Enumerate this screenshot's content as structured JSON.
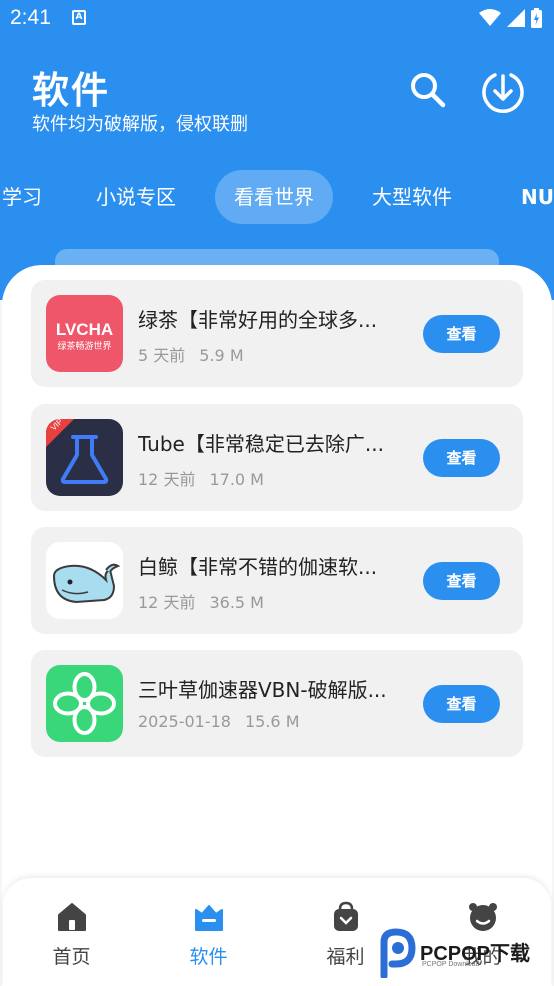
{
  "status_bar": {
    "time": "2:41",
    "notification_badge": "A"
  },
  "header": {
    "title": "软件",
    "subtitle": "软件均为破解版，侵权联删",
    "search_icon": "search-icon",
    "download_icon": "download-icon"
  },
  "tabs": [
    {
      "label": "学习",
      "active": false
    },
    {
      "label": "小说专区",
      "active": false
    },
    {
      "label": "看看世界",
      "active": true
    },
    {
      "label": "大型软件",
      "active": false
    },
    {
      "label": "NU",
      "active": false
    }
  ],
  "apps": [
    {
      "name": "绿茶【非常好用的全球多...",
      "time": "5 天前",
      "size": "5.9 M",
      "button": "查看",
      "icon_text": "LVCHA",
      "icon_subtext": "绿茶畅游世界",
      "icon_color": "#f0566a"
    },
    {
      "name": "Tube【非常稳定已去除广...",
      "time": "12 天前",
      "size": "17.0 M",
      "button": "查看",
      "icon_badge": "VIP",
      "icon_color": "#2a2f45"
    },
    {
      "name": "白鲸【非常不错的伽速软...",
      "time": "12 天前",
      "size": "36.5 M",
      "button": "查看",
      "icon_color": "#ffffff"
    },
    {
      "name": "三叶草伽速器VBN-破解版...",
      "time": "2025-01-18",
      "size": "15.6 M",
      "button": "查看",
      "icon_color": "#3ad67a"
    }
  ],
  "bottom_nav": [
    {
      "label": "首页",
      "icon": "home-icon",
      "active": false
    },
    {
      "label": "软件",
      "icon": "software-icon",
      "active": true
    },
    {
      "label": "福利",
      "icon": "gift-icon",
      "active": false
    },
    {
      "label": "我的",
      "icon": "profile-icon",
      "active": false
    }
  ],
  "watermark": {
    "text": "PCPOP下载",
    "sub": "PCPOP Download"
  },
  "colors": {
    "primary": "#2b8ff0",
    "card_bg": "#f1f1f2",
    "meta_text": "#999999"
  }
}
